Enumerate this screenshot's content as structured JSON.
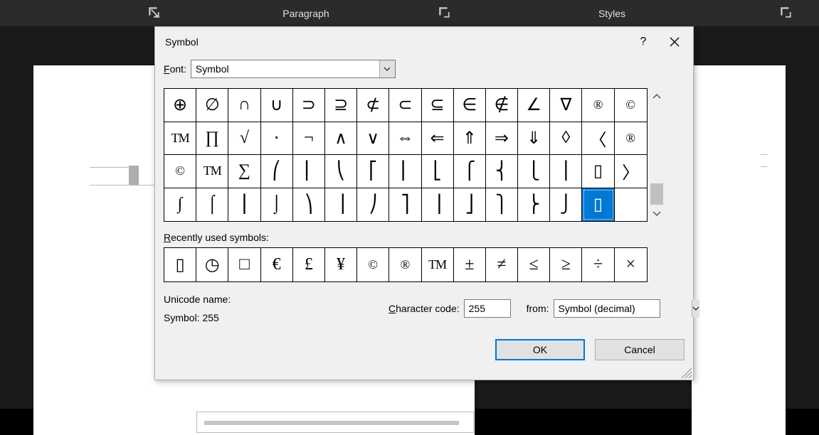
{
  "ribbon": {
    "paragraph_label": "Paragraph",
    "styles_label": "Styles"
  },
  "dialog": {
    "title": "Symbol",
    "font_label_pre": "F",
    "font_label_post": "ont:",
    "font_value": "Symbol",
    "recent_label_pre": "R",
    "recent_label_post": "ecently used symbols:",
    "unicode_name_label": "Unicode name:",
    "symbol_code_line": "Symbol: 255",
    "char_code_label_pre": "C",
    "char_code_label_post": "haracter code:",
    "char_code_value": "255",
    "from_label_pre": "fro",
    "from_label_post": ":",
    "from_label_m": "m",
    "from_value": "Symbol (decimal)",
    "ok": "OK",
    "cancel": "Cancel"
  },
  "grid": {
    "rows": [
      [
        "⊕",
        "∅",
        "∩",
        "∪",
        "⊃",
        "⊇",
        "⊄",
        "⊂",
        "⊆",
        "∈",
        "∉",
        "∠",
        "∇",
        "®",
        "©"
      ],
      [
        "TM",
        "∏",
        "√",
        "⋅",
        "¬",
        "∧",
        "∨",
        "⇔",
        "⇐",
        "⇑",
        "⇒",
        "⇓",
        "◊",
        "〈",
        "®"
      ],
      [
        "©",
        "TM",
        "∑",
        "⎛",
        "⎜",
        "⎝",
        "⎡",
        "⎢",
        "⎣",
        "⎧",
        "⎨",
        "⎩",
        "⎪",
        "▯",
        "〉"
      ],
      [
        "∫",
        "⌠",
        "⎮",
        "⌡",
        "⎞",
        "⎟",
        "⎠",
        "⎤",
        "⎥",
        "⎦",
        "⎫",
        "⎬",
        "⎭",
        "▯",
        ""
      ]
    ],
    "selected_row": 3,
    "selected_col": 13
  },
  "recent": [
    "▯",
    "◷",
    "□",
    "€",
    "£",
    "¥",
    "©",
    "®",
    "TM",
    "±",
    "≠",
    "≤",
    "≥",
    "÷",
    "×"
  ]
}
